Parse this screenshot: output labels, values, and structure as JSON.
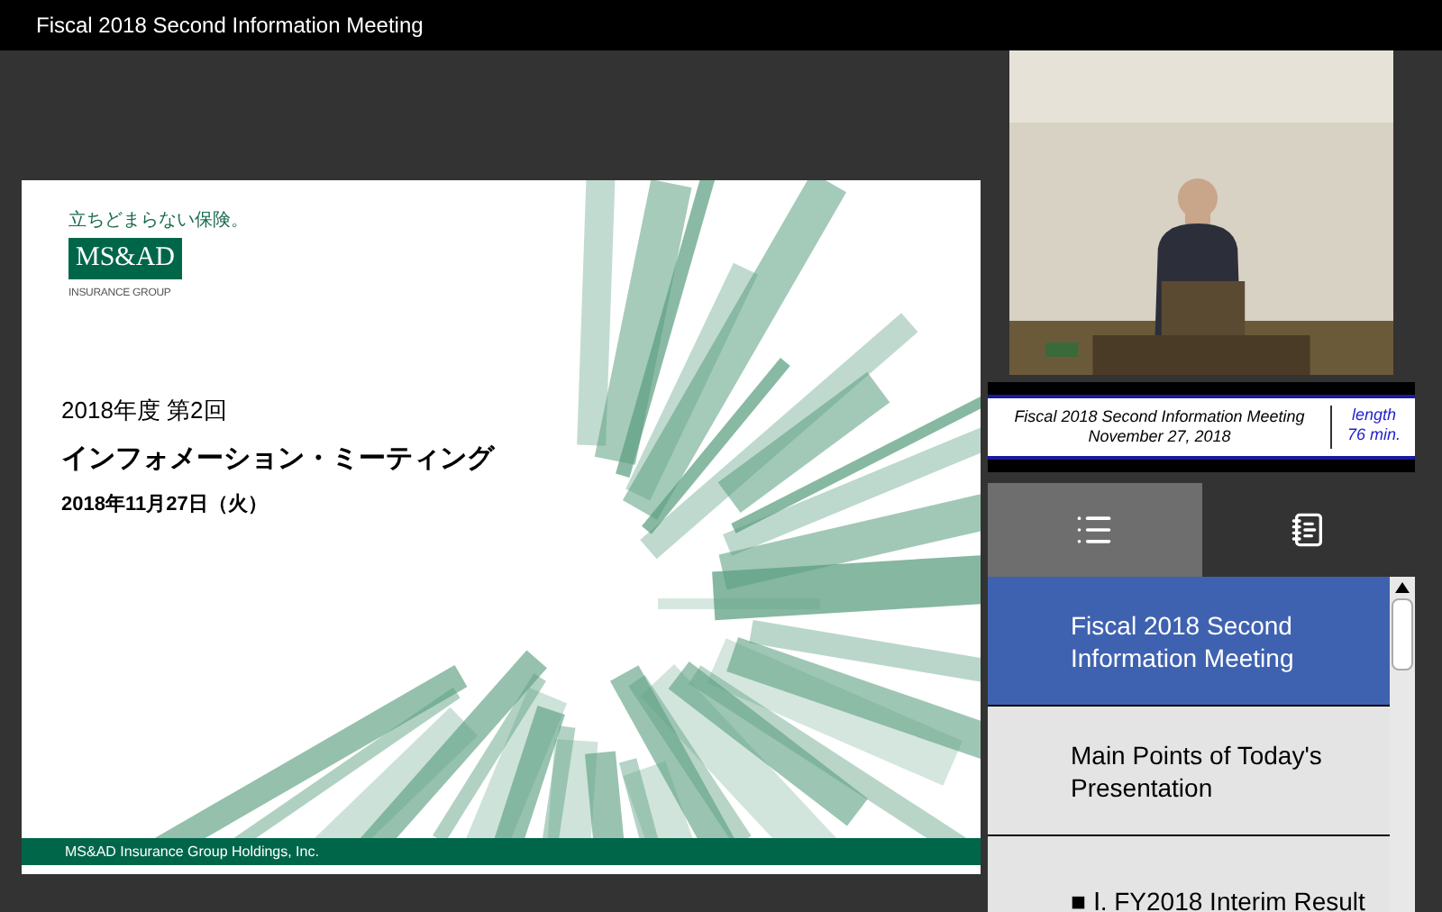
{
  "window": {
    "title": "Fiscal 2018 Second Information Meeting"
  },
  "slide": {
    "tagline": "立ちどまらない保険。",
    "logo": "MS&AD",
    "logo_sub": "INSURANCE GROUP",
    "subtitle": "2018年度 第2回",
    "title": "インフォメーション・ミーティング",
    "date": "2018年11月27日（火）",
    "footer": "MS&AD Insurance Group Holdings, Inc."
  },
  "caption": {
    "title": "Fiscal 2018 Second Information Meeting",
    "date": "November 27, 2018",
    "length_label": "length",
    "length": "76 min."
  },
  "tabs": [
    {
      "kind": "list",
      "selected": true
    },
    {
      "kind": "notes",
      "selected": false
    }
  ],
  "chapters": [
    {
      "label": "Fiscal 2018 Second Information Meeting",
      "selected": true
    },
    {
      "label": "Main Points of Today's Presentation",
      "selected": false
    },
    {
      "label": "■ Ⅰ. FY2018 Interim Result",
      "selected": false
    }
  ]
}
